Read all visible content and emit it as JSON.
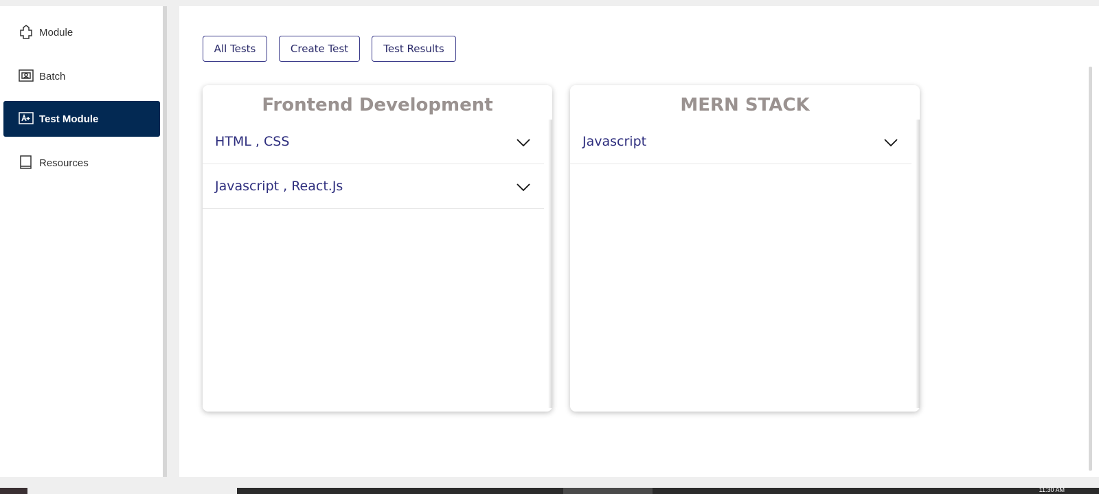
{
  "sidebar": {
    "items": [
      {
        "label": "Module",
        "icon": "module-icon",
        "active": false
      },
      {
        "label": "Batch",
        "icon": "batch-icon",
        "active": false
      },
      {
        "label": "Test Module",
        "icon": "test-module-icon",
        "active": true
      },
      {
        "label": "Resources",
        "icon": "book-icon",
        "active": false
      }
    ]
  },
  "tabs": {
    "all_tests": "All Tests",
    "create_test": "Create Test",
    "test_results": "Test Results"
  },
  "cards": [
    {
      "title": "Frontend Development",
      "rows": [
        {
          "label": "HTML , CSS"
        },
        {
          "label": "Javascript , React.Js"
        }
      ]
    },
    {
      "title": "MERN STACK",
      "rows": [
        {
          "label": "Javascript"
        }
      ]
    }
  ],
  "colors": {
    "accent": "#032953",
    "link": "#2e2e7e",
    "card_title": "#9a9290"
  },
  "taskbar": {
    "clock": "11:30 AM"
  }
}
